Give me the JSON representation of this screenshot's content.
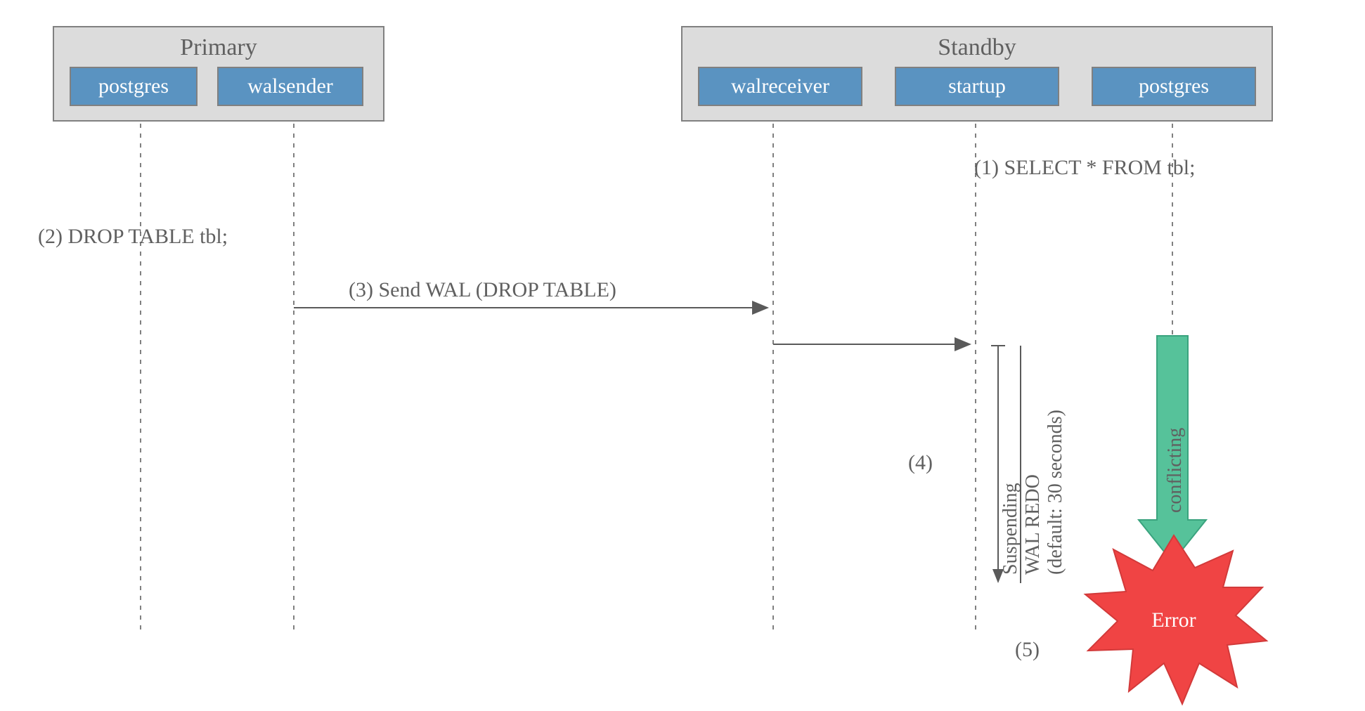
{
  "primary": {
    "title": "Primary",
    "processes": [
      "postgres",
      "walsender"
    ]
  },
  "standby": {
    "title": "Standby",
    "processes": [
      "walreceiver",
      "startup",
      "postgres"
    ]
  },
  "steps": {
    "s1": "(1) SELECT * FROM tbl;",
    "s2": "(2) DROP TABLE tbl;",
    "s3": "(3) Send WAL (DROP TABLE)",
    "s4": "(4)",
    "s5": "(5)"
  },
  "suspend": {
    "line1": "Suspending",
    "line2": "WAL REDO",
    "line3": "(default: 30 seconds)"
  },
  "conflict_label": "conflicting",
  "error_label": "Error",
  "colors": {
    "box_fill": "#dcdcdc",
    "box_stroke": "#808080",
    "proc_fill": "#5a93c1",
    "proc_stroke": "#808080",
    "lifeline": "#808080",
    "arrow": "#5a5a5a",
    "green_arrow": "#56c29a",
    "error_fill": "#f04444"
  }
}
